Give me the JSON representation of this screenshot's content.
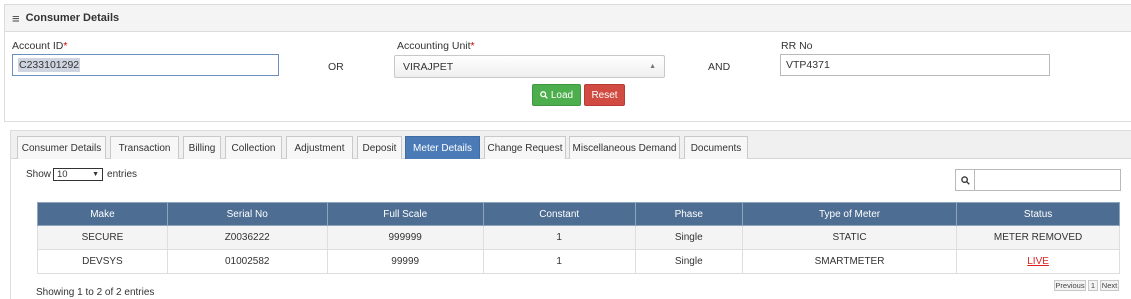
{
  "panel": {
    "title": "Consumer Details",
    "menu_icon": "hamburger-menu-icon"
  },
  "form": {
    "account_id_label": "Account ID",
    "accounting_unit_label": "Accounting Unit",
    "rr_no_label": "RR No",
    "required_mark": "*",
    "account_id_value": "C233101292",
    "accounting_unit_value": "VIRAJPET",
    "rr_no_value": "VTP4371",
    "or_text": "OR",
    "and_text": "AND",
    "load_label": "Load",
    "reset_label": "Reset"
  },
  "tabs": [
    {
      "label": "Consumer Details"
    },
    {
      "label": "Transaction"
    },
    {
      "label": "Billing"
    },
    {
      "label": "Collection"
    },
    {
      "label": "Adjustment"
    },
    {
      "label": "Deposit"
    },
    {
      "label": "Meter Details",
      "active": true
    },
    {
      "label": "Change Request"
    },
    {
      "label": "Miscellaneous Demand"
    },
    {
      "label": "Documents"
    }
  ],
  "listing": {
    "show_label": "Show",
    "entries_label": "entries",
    "page_length": "10",
    "info": "Showing 1 to 2 of 2 entries",
    "previous_label": "Previous",
    "page_number": "1",
    "next_label": "Next"
  },
  "table": {
    "headers": [
      "Make",
      "Serial No",
      "Full Scale",
      "Constant",
      "Phase",
      "Type of Meter",
      "Status"
    ],
    "rows": [
      [
        "SECURE",
        "Z0036222",
        "999999",
        "1",
        "Single",
        "STATIC",
        "METER REMOVED"
      ],
      [
        "DEVSYS",
        "01002582",
        "99999",
        "1",
        "Single",
        "SMARTMETER",
        "LIVE"
      ]
    ]
  },
  "colors": {
    "header_bg": "#4d6d93",
    "active_tab": "#4a7bb7",
    "load_button": "#4cae4c",
    "reset_button": "#d14b43",
    "required_mark": "#cc0000",
    "live_status": "#dd2222"
  }
}
